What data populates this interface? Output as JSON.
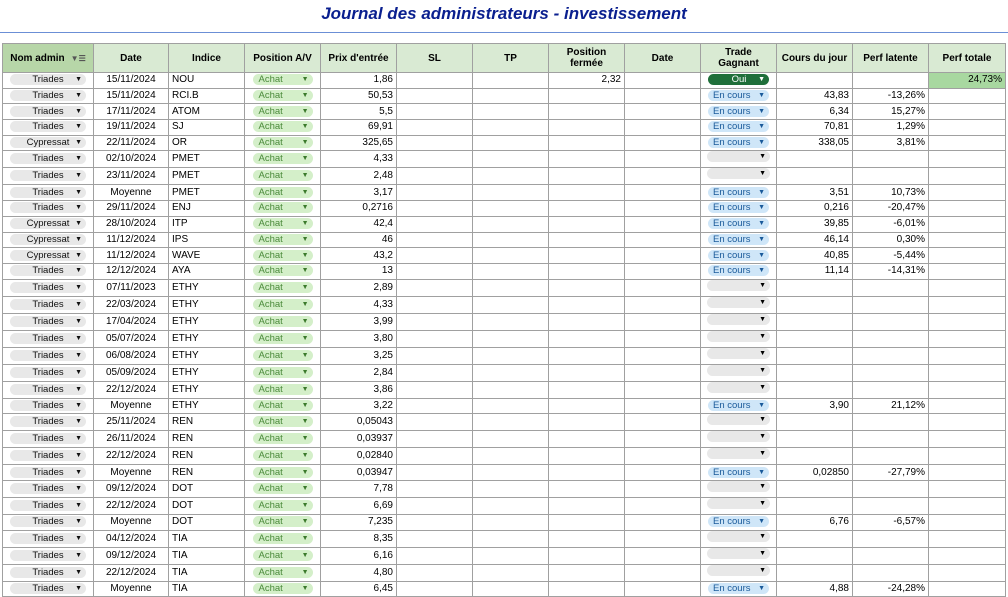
{
  "title": "Journal des administrateurs - investissement",
  "headers": [
    "Nom admin",
    "Date",
    "Indice",
    "Position A/V",
    "Prix d'entrée",
    "SL",
    "TP",
    "Position fermée",
    "Date",
    "Trade Gagnant",
    "Cours du jour",
    "Perf latente",
    "Perf totale"
  ],
  "colors": {
    "header_bg": "#d9ead3",
    "title": "#0a1f8f",
    "achat_chip": "#d4efc9",
    "encours_chip": "#cfe6f8",
    "oui_chip": "#1f6f3a",
    "perf_total_bg": "#a8d8a0"
  },
  "icons": {
    "dropdown": "triangle-down-icon",
    "filter": "filter-icon"
  },
  "rows": [
    {
      "admin": "Triades",
      "date": "15/11/2024",
      "indice": "NOU",
      "pos": "Achat",
      "prix": "1,86",
      "sl": "",
      "tp": "",
      "fermee": "2,32",
      "date2": "",
      "trade": "Oui",
      "cours": "",
      "latente": "",
      "totale": "24,73%"
    },
    {
      "admin": "Triades",
      "date": "15/11/2024",
      "indice": "RCI.B",
      "pos": "Achat",
      "prix": "50,53",
      "sl": "",
      "tp": "",
      "fermee": "",
      "date2": "",
      "trade": "En cours",
      "cours": "43,83",
      "latente": "-13,26%",
      "totale": ""
    },
    {
      "admin": "Triades",
      "date": "17/11/2024",
      "indice": "ATOM",
      "pos": "Achat",
      "prix": "5,5",
      "sl": "",
      "tp": "",
      "fermee": "",
      "date2": "",
      "trade": "En cours",
      "cours": "6,34",
      "latente": "15,27%",
      "totale": ""
    },
    {
      "admin": "Triades",
      "date": "19/11/2024",
      "indice": "SJ",
      "pos": "Achat",
      "prix": "69,91",
      "sl": "",
      "tp": "",
      "fermee": "",
      "date2": "",
      "trade": "En cours",
      "cours": "70,81",
      "latente": "1,29%",
      "totale": ""
    },
    {
      "admin": "Cypressat",
      "date": "22/11/2024",
      "indice": "OR",
      "pos": "Achat",
      "prix": "325,65",
      "sl": "",
      "tp": "",
      "fermee": "",
      "date2": "",
      "trade": "En cours",
      "cours": "338,05",
      "latente": "3,81%",
      "totale": ""
    },
    {
      "admin": "Triades",
      "date": "02/10/2024",
      "indice": "PMET",
      "pos": "Achat",
      "prix": "4,33",
      "sl": "",
      "tp": "",
      "fermee": "",
      "date2": "",
      "trade": "",
      "cours": "",
      "latente": "",
      "totale": ""
    },
    {
      "admin": "Triades",
      "date": "23/11/2024",
      "indice": "PMET",
      "pos": "Achat",
      "prix": "2,48",
      "sl": "",
      "tp": "",
      "fermee": "",
      "date2": "",
      "trade": "",
      "cours": "",
      "latente": "",
      "totale": ""
    },
    {
      "admin": "Triades",
      "date": "Moyenne",
      "indice": "PMET",
      "pos": "Achat",
      "prix": "3,17",
      "sl": "",
      "tp": "",
      "fermee": "",
      "date2": "",
      "trade": "En cours",
      "cours": "3,51",
      "latente": "10,73%",
      "totale": ""
    },
    {
      "admin": "Triades",
      "date": "29/11/2024",
      "indice": "ENJ",
      "pos": "Achat",
      "prix": "0,2716",
      "sl": "",
      "tp": "",
      "fermee": "",
      "date2": "",
      "trade": "En cours",
      "cours": "0,216",
      "latente": "-20,47%",
      "totale": ""
    },
    {
      "admin": "Cypressat",
      "date": "28/10/2024",
      "indice": "ITP",
      "pos": "Achat",
      "prix": "42,4",
      "sl": "",
      "tp": "",
      "fermee": "",
      "date2": "",
      "trade": "En cours",
      "cours": "39,85",
      "latente": "-6,01%",
      "totale": ""
    },
    {
      "admin": "Cypressat",
      "date": "11/12/2024",
      "indice": "IPS",
      "pos": "Achat",
      "prix": "46",
      "sl": "",
      "tp": "",
      "fermee": "",
      "date2": "",
      "trade": "En cours",
      "cours": "46,14",
      "latente": "0,30%",
      "totale": ""
    },
    {
      "admin": "Cypressat",
      "date": "11/12/2024",
      "indice": "WAVE",
      "pos": "Achat",
      "prix": "43,2",
      "sl": "",
      "tp": "",
      "fermee": "",
      "date2": "",
      "trade": "En cours",
      "cours": "40,85",
      "latente": "-5,44%",
      "totale": ""
    },
    {
      "admin": "Triades",
      "date": "12/12/2024",
      "indice": "AYA",
      "pos": "Achat",
      "prix": "13",
      "sl": "",
      "tp": "",
      "fermee": "",
      "date2": "",
      "trade": "En cours",
      "cours": "11,14",
      "latente": "-14,31%",
      "totale": ""
    },
    {
      "admin": "Triades",
      "date": "07/11/2023",
      "indice": "ETHY",
      "pos": "Achat",
      "prix": "2,89",
      "sl": "",
      "tp": "",
      "fermee": "",
      "date2": "",
      "trade": "",
      "cours": "",
      "latente": "",
      "totale": ""
    },
    {
      "admin": "Triades",
      "date": "22/03/2024",
      "indice": "ETHY",
      "pos": "Achat",
      "prix": "4,33",
      "sl": "",
      "tp": "",
      "fermee": "",
      "date2": "",
      "trade": "",
      "cours": "",
      "latente": "",
      "totale": ""
    },
    {
      "admin": "Triades",
      "date": "17/04/2024",
      "indice": "ETHY",
      "pos": "Achat",
      "prix": "3,99",
      "sl": "",
      "tp": "",
      "fermee": "",
      "date2": "",
      "trade": "",
      "cours": "",
      "latente": "",
      "totale": ""
    },
    {
      "admin": "Triades",
      "date": "05/07/2024",
      "indice": "ETHY",
      "pos": "Achat",
      "prix": "3,80",
      "sl": "",
      "tp": "",
      "fermee": "",
      "date2": "",
      "trade": "",
      "cours": "",
      "latente": "",
      "totale": ""
    },
    {
      "admin": "Triades",
      "date": "06/08/2024",
      "indice": "ETHY",
      "pos": "Achat",
      "prix": "3,25",
      "sl": "",
      "tp": "",
      "fermee": "",
      "date2": "",
      "trade": "",
      "cours": "",
      "latente": "",
      "totale": ""
    },
    {
      "admin": "Triades",
      "date": "05/09/2024",
      "indice": "ETHY",
      "pos": "Achat",
      "prix": "2,84",
      "sl": "",
      "tp": "",
      "fermee": "",
      "date2": "",
      "trade": "",
      "cours": "",
      "latente": "",
      "totale": ""
    },
    {
      "admin": "Triades",
      "date": "22/12/2024",
      "indice": "ETHY",
      "pos": "Achat",
      "prix": "3,86",
      "sl": "",
      "tp": "",
      "fermee": "",
      "date2": "",
      "trade": "",
      "cours": "",
      "latente": "",
      "totale": ""
    },
    {
      "admin": "Triades",
      "date": "Moyenne",
      "indice": "ETHY",
      "pos": "Achat",
      "prix": "3,22",
      "sl": "",
      "tp": "",
      "fermee": "",
      "date2": "",
      "trade": "En cours",
      "cours": "3,90",
      "latente": "21,12%",
      "totale": ""
    },
    {
      "admin": "Triades",
      "date": "25/11/2024",
      "indice": "REN",
      "pos": "Achat",
      "prix": "0,05043",
      "sl": "",
      "tp": "",
      "fermee": "",
      "date2": "",
      "trade": "",
      "cours": "",
      "latente": "",
      "totale": ""
    },
    {
      "admin": "Triades",
      "date": "26/11/2024",
      "indice": "REN",
      "pos": "Achat",
      "prix": "0,03937",
      "sl": "",
      "tp": "",
      "fermee": "",
      "date2": "",
      "trade": "",
      "cours": "",
      "latente": "",
      "totale": ""
    },
    {
      "admin": "Triades",
      "date": "22/12/2024",
      "indice": "REN",
      "pos": "Achat",
      "prix": "0,02840",
      "sl": "",
      "tp": "",
      "fermee": "",
      "date2": "",
      "trade": "",
      "cours": "",
      "latente": "",
      "totale": ""
    },
    {
      "admin": "Triades",
      "date": "Moyenne",
      "indice": "REN",
      "pos": "Achat",
      "prix": "0,03947",
      "sl": "",
      "tp": "",
      "fermee": "",
      "date2": "",
      "trade": "En cours",
      "cours": "0,02850",
      "latente": "-27,79%",
      "totale": ""
    },
    {
      "admin": "Triades",
      "date": "09/12/2024",
      "indice": "DOT",
      "pos": "Achat",
      "prix": "7,78",
      "sl": "",
      "tp": "",
      "fermee": "",
      "date2": "",
      "trade": "",
      "cours": "",
      "latente": "",
      "totale": ""
    },
    {
      "admin": "Triades",
      "date": "22/12/2024",
      "indice": "DOT",
      "pos": "Achat",
      "prix": "6,69",
      "sl": "",
      "tp": "",
      "fermee": "",
      "date2": "",
      "trade": "",
      "cours": "",
      "latente": "",
      "totale": ""
    },
    {
      "admin": "Triades",
      "date": "Moyenne",
      "indice": "DOT",
      "pos": "Achat",
      "prix": "7,235",
      "sl": "",
      "tp": "",
      "fermee": "",
      "date2": "",
      "trade": "En cours",
      "cours": "6,76",
      "latente": "-6,57%",
      "totale": ""
    },
    {
      "admin": "Triades",
      "date": "04/12/2024",
      "indice": "TIA",
      "pos": "Achat",
      "prix": "8,35",
      "sl": "",
      "tp": "",
      "fermee": "",
      "date2": "",
      "trade": "",
      "cours": "",
      "latente": "",
      "totale": ""
    },
    {
      "admin": "Triades",
      "date": "09/12/2024",
      "indice": "TIA",
      "pos": "Achat",
      "prix": "6,16",
      "sl": "",
      "tp": "",
      "fermee": "",
      "date2": "",
      "trade": "",
      "cours": "",
      "latente": "",
      "totale": ""
    },
    {
      "admin": "Triades",
      "date": "22/12/2024",
      "indice": "TIA",
      "pos": "Achat",
      "prix": "4,80",
      "sl": "",
      "tp": "",
      "fermee": "",
      "date2": "",
      "trade": "",
      "cours": "",
      "latente": "",
      "totale": ""
    },
    {
      "admin": "Triades",
      "date": "Moyenne",
      "indice": "TIA",
      "pos": "Achat",
      "prix": "6,45",
      "sl": "",
      "tp": "",
      "fermee": "",
      "date2": "",
      "trade": "En cours",
      "cours": "4,88",
      "latente": "-24,28%",
      "totale": ""
    }
  ]
}
